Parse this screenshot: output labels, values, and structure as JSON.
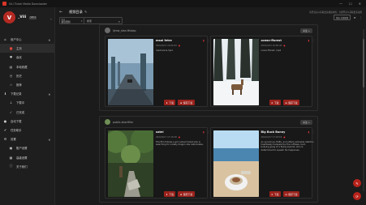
{
  "app": {
    "title": "ViLi Tictok Media Downloader",
    "window_controls": [
      "—",
      "☐",
      "✕"
    ]
  },
  "profile": {
    "initial": "V",
    "name": "_Vili",
    "badge": "VIP 1"
  },
  "sidebar": {
    "items": [
      {
        "label": "用户中心",
        "type": "group",
        "icon": "home-icon"
      },
      {
        "label": "主页",
        "type": "sub",
        "icon": "house-icon",
        "active": true
      },
      {
        "label": "喜欢",
        "type": "sub",
        "icon": "heart-icon"
      },
      {
        "label": "本地收藏",
        "type": "sub",
        "icon": "folder-icon"
      },
      {
        "label": "历史",
        "type": "sub",
        "icon": "history-icon"
      },
      {
        "label": "推荐",
        "type": "sub",
        "icon": "star-icon"
      },
      {
        "label": "下载记录",
        "type": "group",
        "icon": "download-icon"
      },
      {
        "label": "下载中",
        "type": "sub",
        "icon": "downloading-icon"
      },
      {
        "label": "已完成",
        "type": "sub",
        "icon": "check-icon"
      },
      {
        "label": "自动下载",
        "type": "group",
        "icon": "check-circle-icon"
      },
      {
        "label": "任务助手",
        "type": "group",
        "icon": "task-icon"
      },
      {
        "label": "设置",
        "type": "group",
        "icon": "gear-icon"
      },
      {
        "label": "账户设置",
        "type": "sub",
        "icon": "account-icon"
      },
      {
        "label": "高级设置",
        "type": "sub",
        "icon": "advanced-icon"
      },
      {
        "label": "关于我们",
        "type": "sub",
        "icon": "info-icon"
      }
    ]
  },
  "topbar": {
    "page_title": "视频目录",
    "sort_label": "排序",
    "sort_value": "最近更新",
    "search_placeholder": "搜索",
    "notice": "请登录后以获取更多视频内容，立即登录以获取更多权限",
    "filter_chip": "筛选  全部视频",
    "icon_1": "≡",
    "icon_2": "⋮"
  },
  "posts": [
    {
      "author": "ljenw_ston.ftlskap",
      "follow_label": "关注 +",
      "cards": [
        {
          "title": "maol fetre",
          "date": "2022/4/13  10:06:43",
          "desc": "mechanica.mp4",
          "download_label": "下载",
          "save_label": "保存下载"
        },
        {
          "title": "ocean-fforest",
          "date": "2022/4/13  10:06:43",
          "desc": "ocean fforest .mp4",
          "download_label": "下载",
          "save_label": "保存下载"
        }
      ]
    },
    {
      "author": "public-shortfilm",
      "follow_label": "关注 +",
      "cards": [
        {
          "title": "ustel",
          "date": "2022/4/17  17:18:18",
          "desc": "The film follows a girl named Violet who is searching for a baby dragon she calls Scales.",
          "download_label": "下载",
          "save_label": "保存下载"
        },
        {
          "title": "Big Buck Bunny",
          "date": "2022/4/17  17:18:18",
          "desc": "An enormous, fluffy, and utterly adorable rabbit is heartlessly harassed by the ruthless, loud, bullying gang of a flying squirrel, who is determined to squash his happiness.",
          "download_label": "下载",
          "save_label": "保存下载"
        }
      ]
    }
  ],
  "fabs": [
    {
      "icon": "chat-icon",
      "glyph": "✎"
    },
    {
      "icon": "refresh-icon",
      "glyph": "⟳"
    }
  ]
}
